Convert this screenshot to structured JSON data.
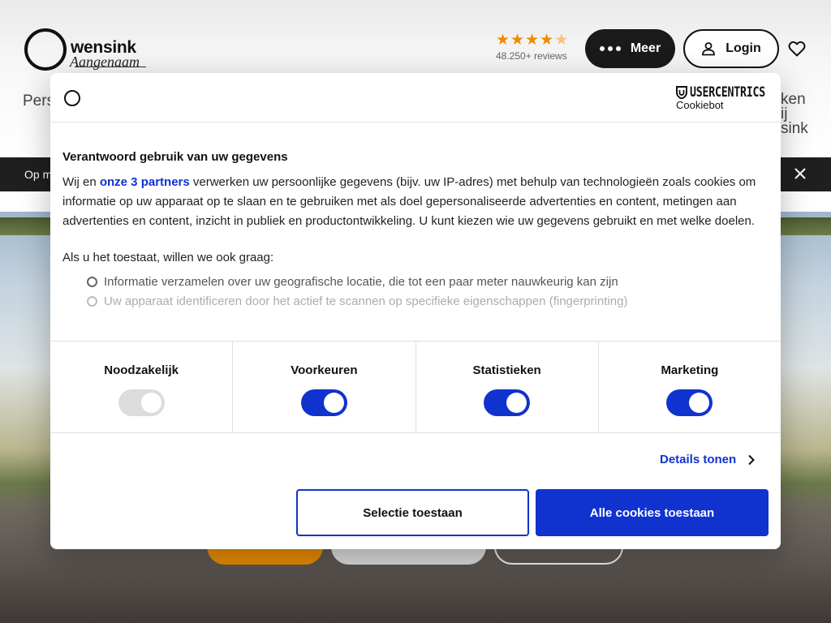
{
  "site": {
    "logo_word": "wensink",
    "logo_sub": "Aangenaam",
    "rating_stars": 4.5,
    "reviews": "48.250+ reviews",
    "meer_label": "Meer",
    "login_label": "Login",
    "nav_left": "Pers",
    "nav_right_lines": [
      "ken",
      "ij",
      "sink"
    ],
    "banner_text": "Op m"
  },
  "dialog": {
    "brand_name": "USERCENTRICS",
    "brand_sub": "Cookiebot",
    "title": "Verantwoord gebruik van uw gegevens",
    "text_prefix": "Wij en ",
    "partners_link": "onze 3 partners",
    "text_suffix": " verwerken uw persoonlijke gegevens (bijv. uw IP-adres) met behulp van technologieën zoals cookies om informatie op uw apparaat op te slaan en te gebruiken met als doel gepersonaliseerde advertenties en content, metingen aan advertenties en content, inzicht in publiek en productontwikkeling. U kunt kiezen wie uw gegevens gebruikt en met welke doelen.",
    "allow_intro": "Als u het toestaat, willen we ook graag:",
    "options": [
      "Informatie verzamelen over uw geografische locatie, die tot een paar meter nauwkeurig kan zijn",
      "Uw apparaat identificeren door het actief te scannen op specifieke eigenschappen (fingerprinting)"
    ],
    "categories": [
      {
        "label": "Noodzakelijk",
        "enabled": true,
        "locked": true
      },
      {
        "label": "Voorkeuren",
        "enabled": true,
        "locked": false
      },
      {
        "label": "Statistieken",
        "enabled": true,
        "locked": false
      },
      {
        "label": "Marketing",
        "enabled": true,
        "locked": false
      }
    ],
    "details_label": "Details tonen",
    "selectie_label": "Selectie toestaan",
    "alle_label": "Alle cookies toestaan"
  },
  "colors": {
    "accent": "#1032cf",
    "orange": "#e58a00"
  }
}
